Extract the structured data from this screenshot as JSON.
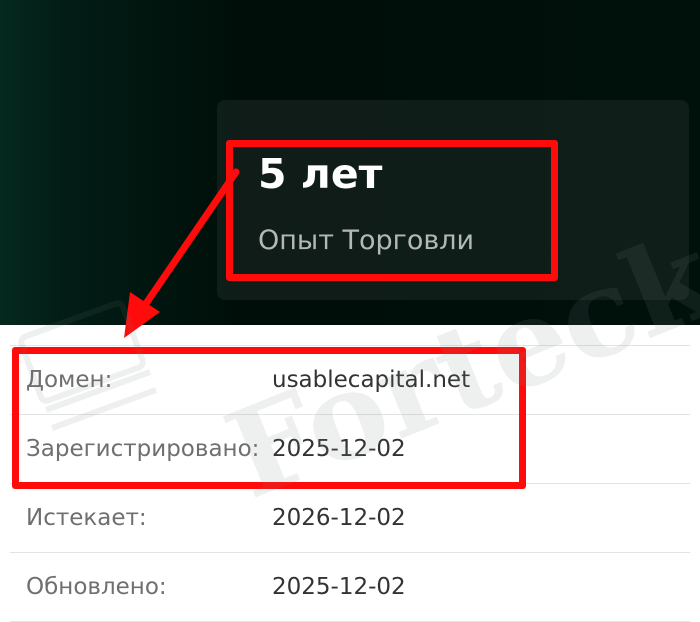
{
  "stat_card": {
    "value": "5 лет",
    "label": "Опыт Торговли"
  },
  "whois": [
    {
      "key": "Домен:",
      "value": "usablecapital.net"
    },
    {
      "key": "Зарегистрировано:",
      "value": "2025-12-02"
    },
    {
      "key": "Истекает:",
      "value": "2026-12-02"
    },
    {
      "key": "Обновлено:",
      "value": "2025-12-02"
    }
  ],
  "watermark": {
    "text": "Forteck"
  },
  "colors": {
    "highlight": "#ff0b0b",
    "panel_bg": "#00100b"
  }
}
